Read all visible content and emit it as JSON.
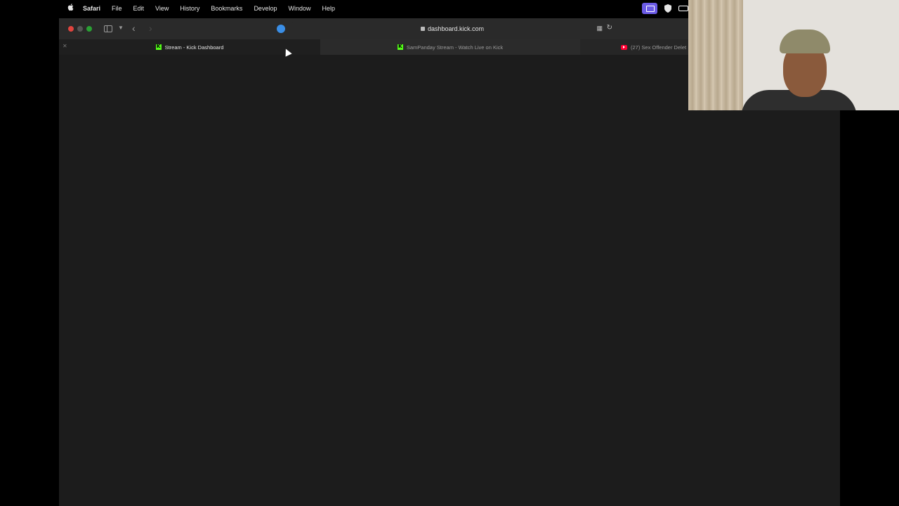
{
  "menubar": {
    "app_name": "Safari",
    "items": [
      "File",
      "Edit",
      "View",
      "History",
      "Bookmarks",
      "Develop",
      "Window",
      "Help"
    ]
  },
  "browser": {
    "address": "dashboard.kick.com",
    "tabs": [
      {
        "title": "Stream - Kick Dashboard",
        "icon": "kick-icon",
        "active": true
      },
      {
        "title": "SamPanday Stream - Watch Live on Kick",
        "icon": "kick-icon",
        "active": false
      },
      {
        "title": "(27) Sex Offender Delet",
        "icon": "youtube-icon",
        "active": false
      }
    ]
  },
  "colors": {
    "kick_green": "#53fc18",
    "close": "#e0443e",
    "maximize": "#2aa034"
  }
}
